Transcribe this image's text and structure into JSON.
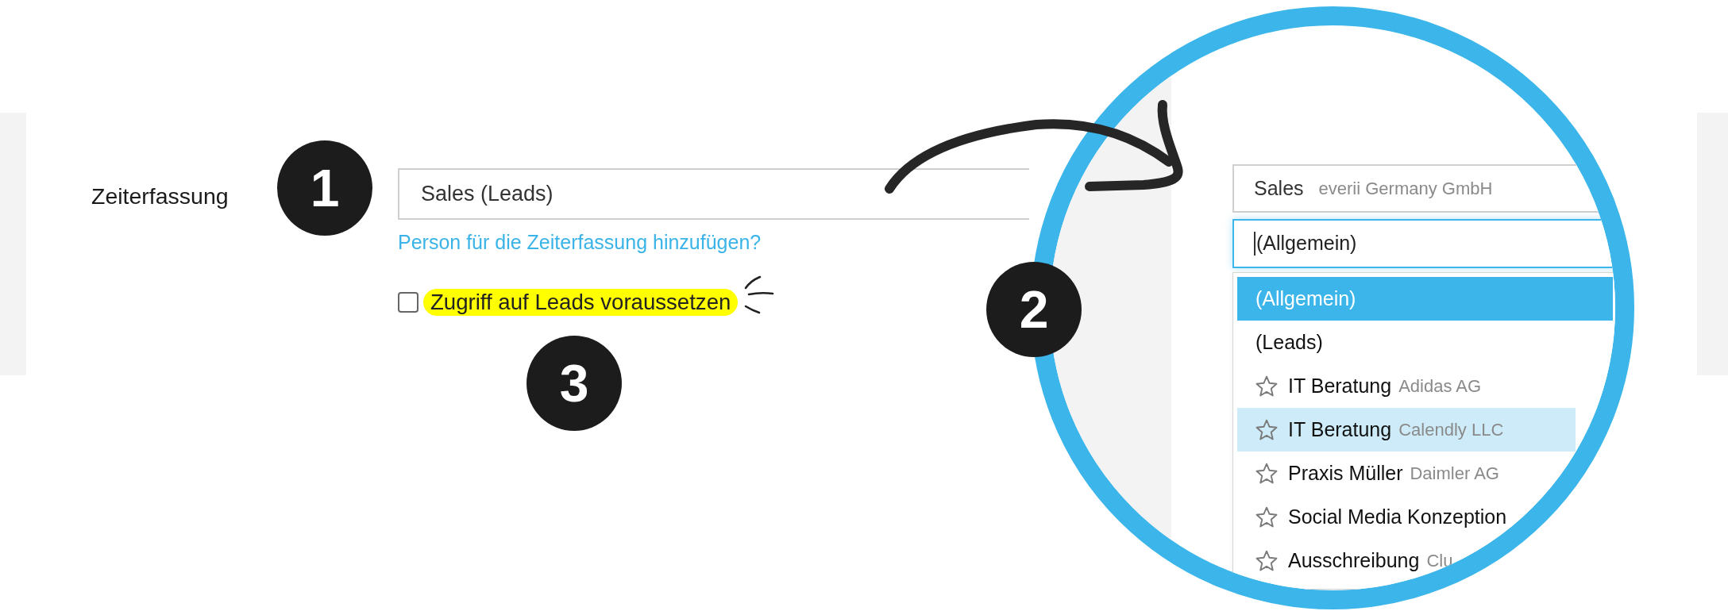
{
  "form": {
    "label": "Zeiterfassung",
    "step_badge": "1",
    "select": {
      "value": "Sales (Leads)"
    },
    "link": "Person für die Zeiterfassung hinzufügen?",
    "checkbox": {
      "label": "Zugriff auf Leads voraussetzen",
      "checked": false,
      "highlighted": true,
      "step_badge": "3"
    }
  },
  "magnifier": {
    "step_badge": "2",
    "project_field": {
      "value": "Sales",
      "company": "everii Germany GmbH"
    },
    "search_field": {
      "value": "(Allgemein)"
    },
    "options": [
      {
        "kind": "group",
        "label": "(Allgemein)",
        "selected": true,
        "highlighted": false
      },
      {
        "kind": "group",
        "label": "(Leads)",
        "selected": false,
        "highlighted": false
      },
      {
        "kind": "project",
        "label": "IT Beratung",
        "company": "Adidas AG",
        "favorite": false,
        "selected": false,
        "highlighted": false
      },
      {
        "kind": "project",
        "label": "IT Beratung",
        "company": "Calendly LLC",
        "favorite": false,
        "selected": false,
        "highlighted": true
      },
      {
        "kind": "project",
        "label": "Praxis Müller",
        "company": "Daimler AG",
        "favorite": false,
        "selected": false,
        "highlighted": false
      },
      {
        "kind": "project",
        "label": "Social Media Konzeption",
        "favorite": false,
        "selected": false,
        "highlighted": false
      },
      {
        "kind": "project",
        "label": "Ausschreibung",
        "company": "Clu",
        "favorite": false,
        "selected": false,
        "highlighted": false
      }
    ]
  }
}
